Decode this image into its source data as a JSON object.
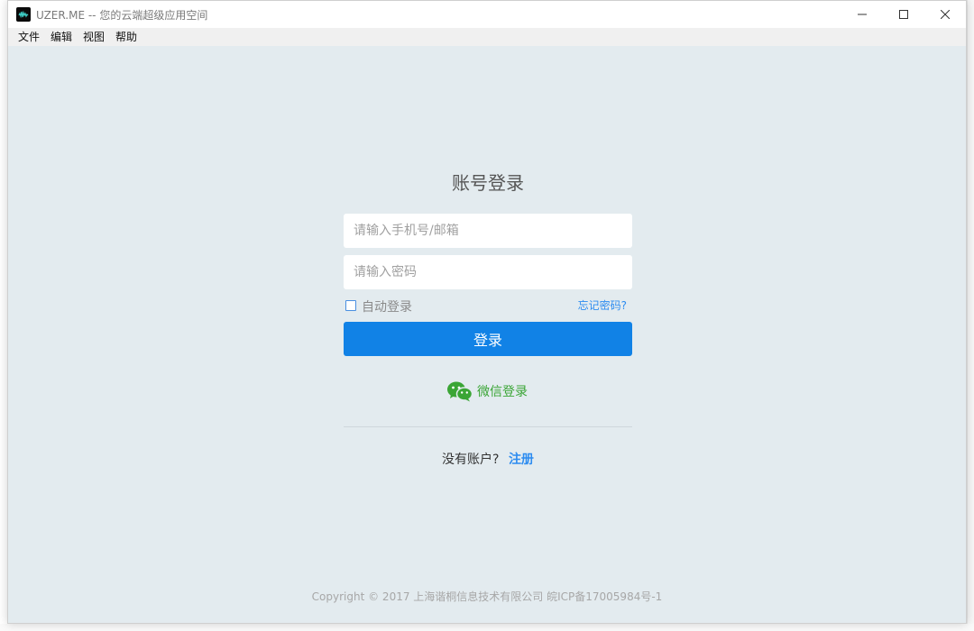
{
  "window": {
    "title": "UZER.ME -- 您的云端超级应用空间",
    "icon": "app-logo-icon"
  },
  "menu": {
    "items": [
      {
        "label": "文件"
      },
      {
        "label": "编辑"
      },
      {
        "label": "视图"
      },
      {
        "label": "帮助"
      }
    ]
  },
  "login": {
    "title": "账号登录",
    "phone_placeholder": "请输入手机号/邮箱",
    "password_placeholder": "请输入密码",
    "auto_login_label": "自动登录",
    "forgot_password": "忘记密码?",
    "login_button": "登录",
    "wechat_login": "微信登录",
    "no_account": "没有账户?",
    "register": "注册"
  },
  "footer": {
    "copyright": "Copyright © 2017 上海谐桐信息技术有限公司 皖ICP备17005984号-1"
  },
  "colors": {
    "accent": "#1182e6",
    "link": "#2d8cf0",
    "wechat": "#3aa535",
    "background": "#e3ebef"
  }
}
